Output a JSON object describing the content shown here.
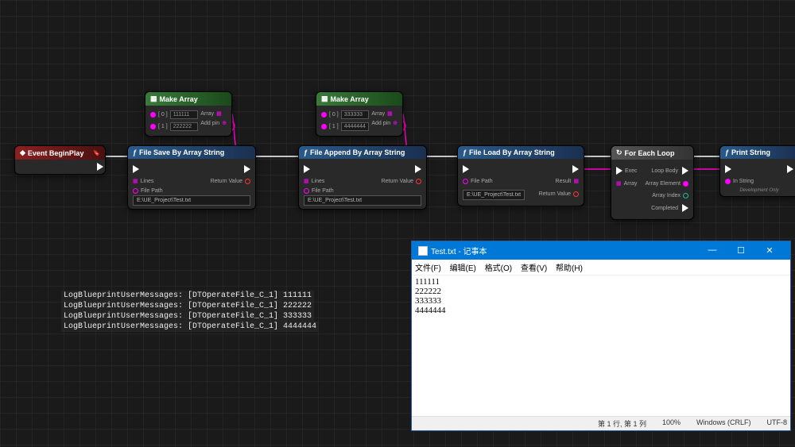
{
  "nodes": {
    "eventBeginPlay": {
      "title": "Event BeginPlay"
    },
    "makeArray1": {
      "title": "Make Array",
      "in0": "[ 0 ]",
      "in1": "[ 1 ]",
      "val0": "111111",
      "val1": "222222",
      "arrayLabel": "Array",
      "addPin": "Add pin"
    },
    "makeArray2": {
      "title": "Make Array",
      "in0": "[ 0 ]",
      "in1": "[ 1 ]",
      "val0": "333333",
      "val1": "4444444",
      "arrayLabel": "Array",
      "addPin": "Add pin"
    },
    "fileSave": {
      "title": "File Save By Array String",
      "linesLabel": "Lines",
      "filePathLabel": "File Path",
      "filePath": "E:\\UE_Project\\Test.txt",
      "returnValue": "Return Value"
    },
    "fileAppend": {
      "title": "File Append By Array String",
      "linesLabel": "Lines",
      "filePathLabel": "File Path",
      "filePath": "E:\\UE_Project\\Test.txt",
      "returnValue": "Return Value"
    },
    "fileLoad": {
      "title": "File Load By Array String",
      "filePathLabel": "File Path",
      "filePath": "E:\\UE_Project\\Test.txt",
      "resultLabel": "Result",
      "returnValue": "Return Value"
    },
    "forEach": {
      "title": "For Each Loop",
      "execLabel": "Exec",
      "arrayLabel": "Array",
      "loopBody": "Loop Body",
      "arrayElement": "Array Element",
      "arrayIndex": "Array Index",
      "completed": "Completed"
    },
    "printString": {
      "title": "Print String",
      "inString": "In String",
      "devOnly": "Development Only"
    }
  },
  "log": {
    "line1": "LogBlueprintUserMessages: [DTOperateFile_C_1] 111111",
    "line2": "LogBlueprintUserMessages: [DTOperateFile_C_1] 222222",
    "line3": "LogBlueprintUserMessages: [DTOperateFile_C_1] 333333",
    "line4": "LogBlueprintUserMessages: [DTOperateFile_C_1] 4444444"
  },
  "notepad": {
    "title": "Test.txt - 记事本",
    "menu": {
      "file": "文件(F)",
      "edit": "编辑(E)",
      "format": "格式(O)",
      "view": "查看(V)",
      "help": "帮助(H)"
    },
    "content": {
      "l1": "111111",
      "l2": "222222",
      "l3": "333333",
      "l4": "4444444"
    },
    "status": {
      "pos": "第 1 行, 第 1 列",
      "zoom": "100%",
      "eol": "Windows (CRLF)",
      "enc": "UTF-8"
    }
  }
}
